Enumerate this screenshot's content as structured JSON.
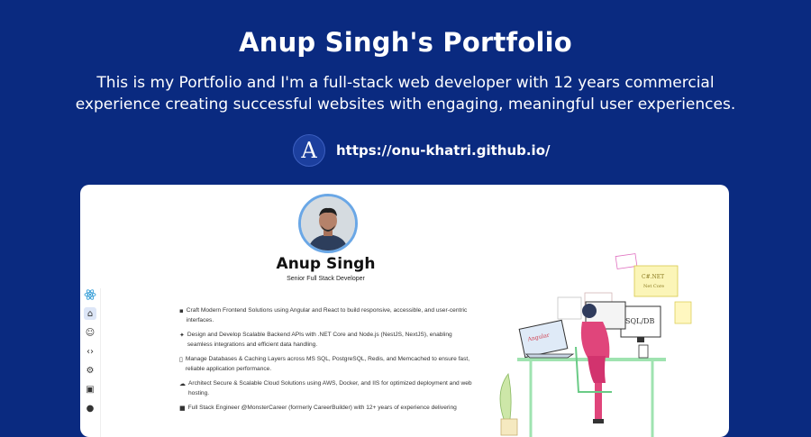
{
  "header": {
    "title": "Anup Singh's Portfolio",
    "description": "This is my Portfolio and I'm a full-stack web developer with 12 years commercial experience creating successful websites with engaging, meaningful user experiences.",
    "logo_letter": "A",
    "url": "https://onu-khatri.github.io/"
  },
  "card": {
    "name": "Anup Singh",
    "role": "Senior Full Stack Developer",
    "sidebar_icons": [
      "react-logo-icon",
      "home-icon",
      "user-icon",
      "code-icon",
      "gear-icon",
      "briefcase-icon",
      "github-icon"
    ],
    "bullets": [
      {
        "icon": "monitor-icon",
        "text": "Craft Modern Frontend Solutions using Angular and React to build responsive, accessible, and user-centric interfaces."
      },
      {
        "icon": "tools-icon",
        "text": "Design and Develop Scalable Backend APIs with .NET Core and Node.js (NestJS, NextJS), enabling seamless integrations and efficient data handling."
      },
      {
        "icon": "database-icon",
        "text": "Manage Databases & Caching Layers across MS SQL, PostgreSQL, Redis, and Memcached to ensure fast, reliable application performance."
      },
      {
        "icon": "cloud-icon",
        "text": "Architect Secure & Scalable Cloud Solutions using AWS, Docker, and IIS for optimized deployment and web hosting."
      },
      {
        "icon": "badge-icon",
        "text": "Full Stack Engineer @MonsterCareer (formerly CareerBuilder) with 12+ years of experience delivering"
      }
    ],
    "illustration_labels": {
      "sql": "SQL/DB",
      "angular": "Angular",
      "dotnet": "C#.NET\nNet Core"
    }
  },
  "colors": {
    "background": "#0a2a80",
    "card": "#ffffff",
    "accent_pink": "#e0457b"
  }
}
